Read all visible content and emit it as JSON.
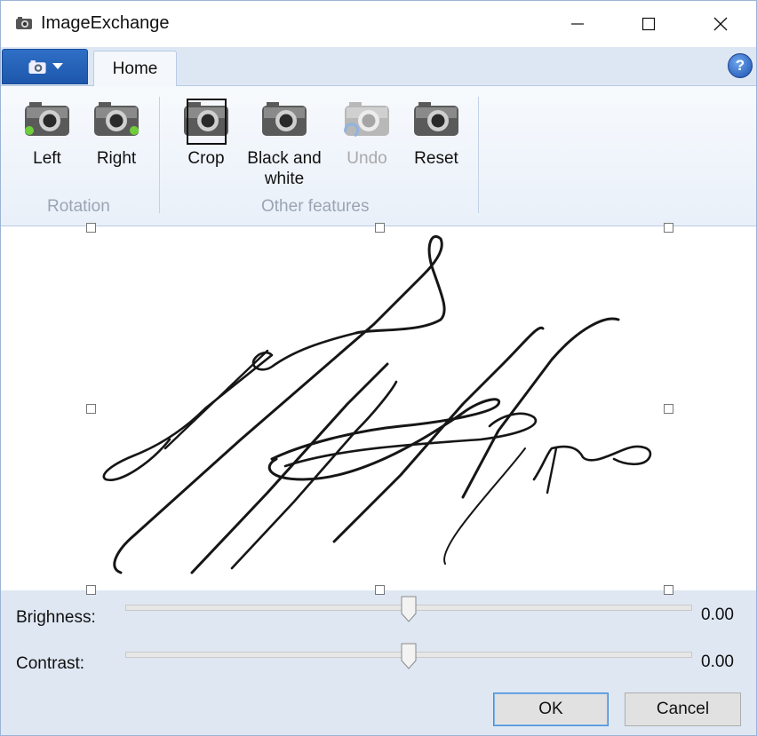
{
  "window": {
    "title": "ImageExchange"
  },
  "tabs": {
    "home": "Home"
  },
  "groups": {
    "rotation": "Rotation",
    "other": "Other features"
  },
  "buttons": {
    "left": "Left",
    "right": "Right",
    "crop": "Crop",
    "bw_line1": "Black and",
    "bw_line2": "white",
    "undo": "Undo",
    "reset": "Reset"
  },
  "adjust": {
    "brightness_label": "Brighness:",
    "brightness_value": "0.00",
    "contrast_label": "Contrast:",
    "contrast_value": "0.00"
  },
  "dialog": {
    "ok": "OK",
    "cancel": "Cancel"
  },
  "icons": {
    "app": "camera-icon",
    "help": "help-icon",
    "rotate_left": "rotate-left-icon",
    "rotate_right": "rotate-right-icon"
  },
  "colors": {
    "file_button": "#2f6fc6",
    "ribbon_bg": "#dde7f4",
    "panel_bg": "#dfe7f2",
    "ok_border": "#4a8fd8"
  }
}
